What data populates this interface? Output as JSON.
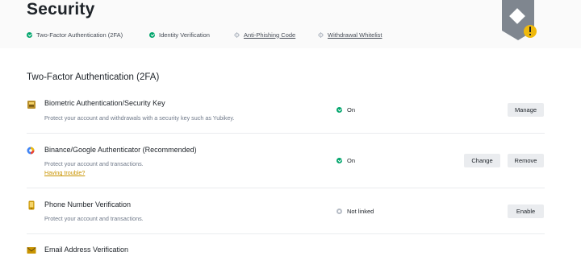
{
  "page": {
    "title": "Security"
  },
  "status_items": [
    {
      "label": "Two-Factor Authentication (2FA)",
      "state": "done"
    },
    {
      "label": "Identity Verification",
      "state": "done"
    },
    {
      "label": "Anti-Phishing Code",
      "state": "pending"
    },
    {
      "label": "Withdrawal Whitelist",
      "state": "pending"
    }
  ],
  "section": {
    "title": "Two-Factor Authentication (2FA)"
  },
  "rows": [
    {
      "title": "Biometric Authentication/Security Key",
      "desc": "Protect your account and withdrawals with a security key such as Yubikey.",
      "status": "On",
      "buttons": [
        "Manage"
      ],
      "icon": "security-key-icon"
    },
    {
      "title": "Binance/Google Authenticator (Recommended)",
      "desc": "Protect your account and transactions.",
      "link": "Having trouble?",
      "status": "On",
      "buttons": [
        "Change",
        "Remove"
      ],
      "icon": "authenticator-icon"
    },
    {
      "title": "Phone Number Verification",
      "desc": "Protect your account and transactions.",
      "status": "Not linked",
      "buttons": [
        "Enable"
      ],
      "icon": "phone-icon"
    },
    {
      "title": "Email Address Verification",
      "icon": "email-icon"
    }
  ],
  "colors": {
    "accent": "#f0b90b",
    "success": "#03a66d",
    "link": "#c99400",
    "muted": "#707a8a",
    "button_bg": "#eaecef"
  }
}
